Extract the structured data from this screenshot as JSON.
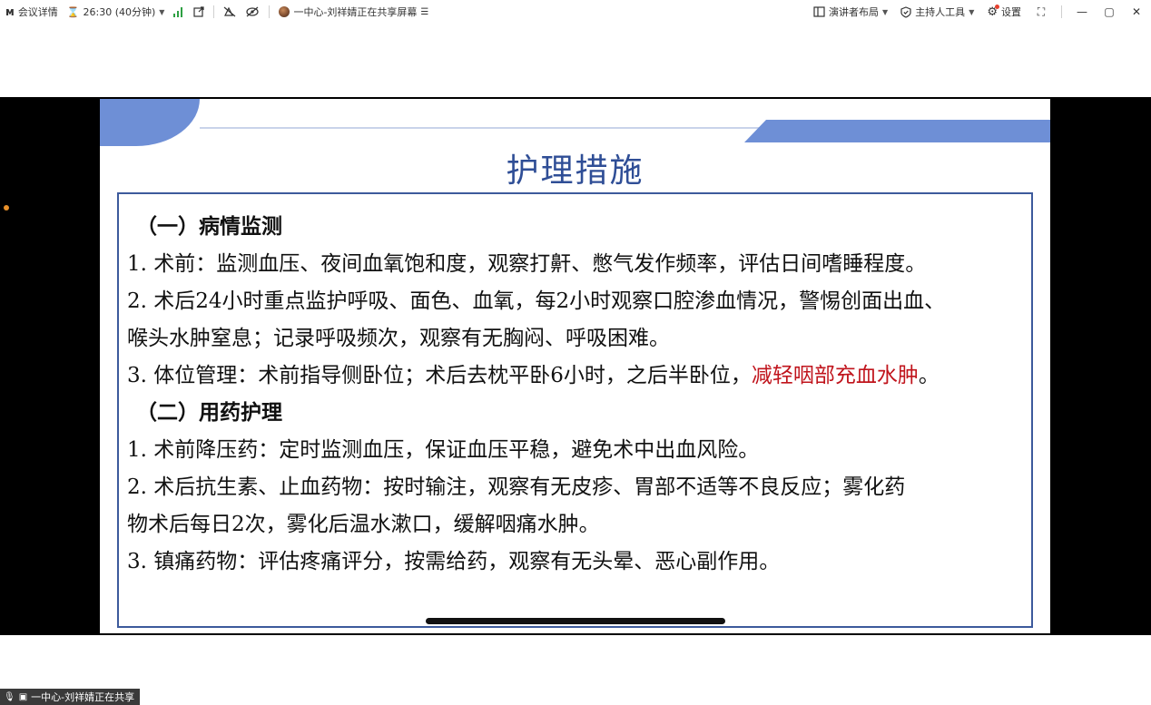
{
  "topbar": {
    "meeting_details": "会议详情",
    "timer": "26:30 (40分钟)",
    "sharer_label": "一中心-刘祥婧正在共享屏幕",
    "presenter_layout": "演讲者布局",
    "host_tools": "主持人工具",
    "settings": "设置"
  },
  "slide": {
    "title": "护理措施",
    "section1_heading": "（一）病情监测",
    "s1_item1": "1.  术前：监测血压、夜间血氧饱和度，观察打鼾、憋气发作频率，评估日间嗜睡程度。",
    "s1_item2_line1": "2.  术后24小时重点监护呼吸、面色、血氧，每2小时观察口腔渗血情况，警惕创面出血、",
    "s1_item2_line2": "喉头水肿窒息；记录呼吸频次，观察有无胸闷、呼吸困难。",
    "s1_item3_prefix": "3.  体位管理：术前指导侧卧位；术后去枕平卧6小时，之后半卧位，",
    "s1_item3_highlight": "减轻咽部充血水肿",
    "s1_item3_suffix": "。",
    "section2_heading": "（二）用药护理",
    "s2_item1": "1.  术前降压药：定时监测血压，保证血压平稳，避免术中出血风险。",
    "s2_item2_line1": "2.  术后抗生素、止血药物：按时输注，观察有无皮疹、胃部不适等不良反应；雾化药",
    "s2_item2_line2": "物术后每日2次，雾化后温水漱口，缓解咽痛水肿。",
    "s2_item3": "3.  镇痛药物：评估疼痛评分，按需给药，观察有无头晕、恶心副作用。"
  },
  "footer": {
    "share_tag": "一中心-刘祥婧正在共享"
  },
  "colors": {
    "slide_accent": "#6e8fd6",
    "title_color": "#2f4e96",
    "highlight_red": "#c0141c"
  }
}
